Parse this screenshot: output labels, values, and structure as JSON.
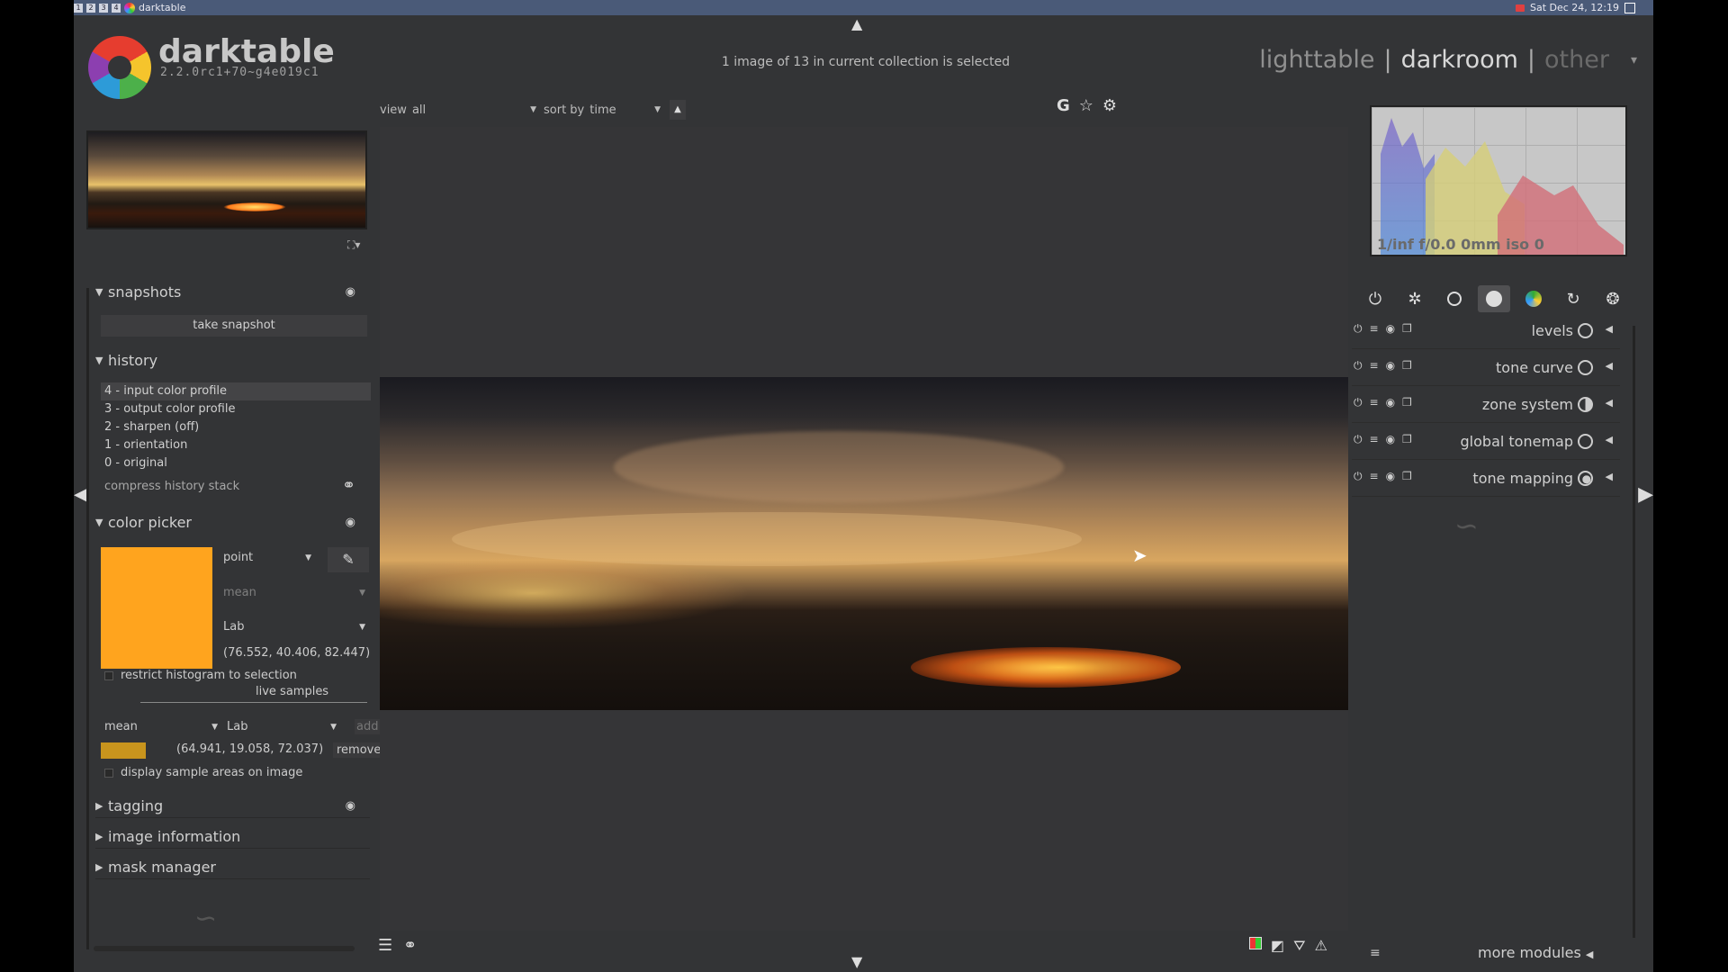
{
  "system_bar": {
    "workspaces": [
      "1",
      "2",
      "3",
      "4"
    ],
    "app_title": "darktable",
    "datetime": "Sat Dec 24, 12:19"
  },
  "header": {
    "app_name": "darktable",
    "version": "2.2.0rc1+70~g4e019c1",
    "selection_status": "1 image of 13 in current collection is selected",
    "views": {
      "lighttable": "lighttable",
      "darkroom": "darkroom",
      "other": "other",
      "separator": "|"
    }
  },
  "filter_bar": {
    "view_label": "view",
    "view_value": "all",
    "sort_label": "sort by",
    "sort_value": "time",
    "sort_direction_icon": "▲"
  },
  "left_panel": {
    "snapshots": {
      "title": "snapshots",
      "take_snapshot": "take snapshot"
    },
    "history": {
      "title": "history",
      "items": [
        "4 - input color profile",
        "3 - output color profile",
        "2 - sharpen (off)",
        "1 - orientation",
        "0 - original"
      ],
      "active_index": 0,
      "compress": "compress history stack"
    },
    "color_picker": {
      "title": "color picker",
      "mode": "point",
      "statistic": "mean",
      "color_space": "Lab",
      "values": "(76.552, 40.406, 82.447)",
      "swatch_color": "#ffa41e",
      "restrict_histogram": "restrict histogram to selection",
      "live_samples": "live samples",
      "sample_statistic": "mean",
      "sample_space": "Lab",
      "add": "add",
      "sample_values": "(64.941, 19.058, 72.037)",
      "sample_color": "#c8941d",
      "remove": "remove",
      "display_sample_areas": "display sample areas on image"
    },
    "collapsed_modules": [
      "tagging",
      "image information",
      "mask manager"
    ]
  },
  "right_panel": {
    "exif": "1/inf f/0.0 0mm iso 0",
    "group_tab_icons": [
      "power-icon",
      "favorites-icon",
      "basic-group-icon",
      "tone-group-icon",
      "color-group-icon",
      "correct-group-icon",
      "effect-group-icon"
    ],
    "active_group": 3,
    "modules": [
      {
        "name": "levels",
        "icon": "levels-icon"
      },
      {
        "name": "tone curve",
        "icon": "tone-curve-icon"
      },
      {
        "name": "zone system",
        "icon": "zone-system-icon"
      },
      {
        "name": "global tonemap",
        "icon": "global-tonemap-icon"
      },
      {
        "name": "tone mapping",
        "icon": "tone-mapping-icon"
      }
    ],
    "more_modules": "more modules"
  }
}
